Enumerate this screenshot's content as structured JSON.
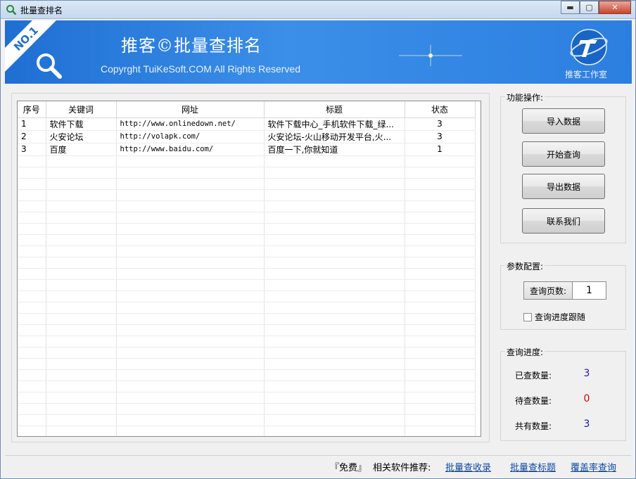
{
  "window": {
    "title": "批量查排名",
    "minimize": "▬",
    "maximize": "▢",
    "close": "✕"
  },
  "banner": {
    "ribbon": "NO.1",
    "title": "推客©批量查排名",
    "copyright": "Copyrght TuiKeSoft.COM All Rights Reserved",
    "logo_text": "推客工作室"
  },
  "table": {
    "headers": [
      "序号",
      "关键词",
      "网址",
      "标题",
      "状态"
    ],
    "rows": [
      [
        "1",
        "软件下载",
        "http://www.onlinedown.net/",
        "软件下载中心_手机软件下载_绿...",
        "3"
      ],
      [
        "2",
        "火安论坛",
        "http://volapk.com/",
        "火安论坛-火山移动开发平台,火...",
        "3"
      ],
      [
        "3",
        "百度",
        "http://www.baidu.com/",
        "百度一下,你就知道",
        "1"
      ]
    ]
  },
  "functions": {
    "legend": "功能操作:",
    "import": "导入数据",
    "start": "开始查询",
    "export": "导出数据",
    "contact": "联系我们"
  },
  "params": {
    "legend": "参数配置:",
    "pages_label": "查询页数:",
    "pages_value": "1",
    "follow_label": "查询进度跟随"
  },
  "progress": {
    "legend": "查询进度:",
    "done_label": "已查数量:",
    "done_value": "3",
    "pending_label": "待查数量:",
    "pending_value": "0",
    "total_label": "共有数量:",
    "total_value": "3"
  },
  "status": {
    "free": "『免费』",
    "recommend": "相关软件推荐:",
    "link1": "批量查收录",
    "link2": "批量查标题",
    "link3": "覆盖率查询"
  },
  "colors": {
    "banner": "#2c7fe0",
    "value_blue": "#1a1aa6",
    "value_red": "#d40000",
    "link": "#0d47a1"
  }
}
